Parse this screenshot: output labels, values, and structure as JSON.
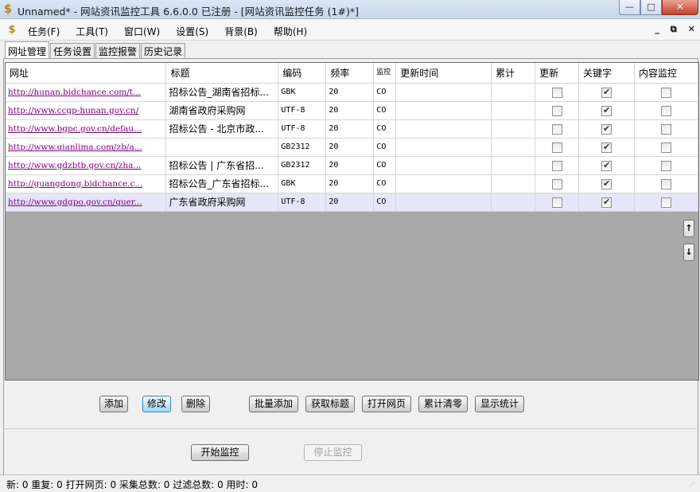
{
  "window": {
    "title": "Unnamed* - 网站资讯监控工具 6.6.0.0  已注册 - [网站资讯监控任务  (1#)*]",
    "app_icon": "$",
    "min_glyph": "—",
    "max_glyph": "□",
    "close_glyph": "✕"
  },
  "menu": {
    "items": [
      "任务(F)",
      "工具(T)",
      "窗口(W)",
      "设置(S)",
      "背景(B)",
      "帮助(H)"
    ],
    "mdi_min": "_",
    "mdi_restore": "⧉",
    "mdi_close": "✕"
  },
  "tabs": [
    "网址管理",
    "任务设置",
    "监控报警",
    "历史记录"
  ],
  "grid": {
    "columns": [
      "网址",
      "标题",
      "编码",
      "频率",
      "监控",
      "更新时间",
      "累计",
      "更新",
      "关键字",
      "内容监控"
    ],
    "rows": [
      {
        "url": "http://hunan.bidchance.com/t...",
        "title": "招标公告_湖南省招标...",
        "encoding": "GBK",
        "freq": "20",
        "monitor": "CO",
        "update_time": "",
        "total": "",
        "update": false,
        "keyword": true,
        "content": false
      },
      {
        "url": "http://www.ccgp-hunan.gov.cn/",
        "title": "湖南省政府采购网",
        "encoding": "UTF-8",
        "freq": "20",
        "monitor": "CO",
        "update_time": "",
        "total": "",
        "update": false,
        "keyword": true,
        "content": false
      },
      {
        "url": "http://www.bgpc.gov.cn/defau...",
        "title": "招标公告 - 北京市政...",
        "encoding": "UTF-8",
        "freq": "20",
        "monitor": "CO",
        "update_time": "",
        "total": "",
        "update": false,
        "keyword": true,
        "content": false
      },
      {
        "url": "http://www.qianlima.com/zb/a...",
        "title": "",
        "encoding": "GB2312",
        "freq": "20",
        "monitor": "CO",
        "update_time": "",
        "total": "",
        "update": false,
        "keyword": true,
        "content": false
      },
      {
        "url": "http://www.gdzbtb.gov.cn/zha...",
        "title": "招标公告 | 广东省招...",
        "encoding": "GB2312",
        "freq": "20",
        "monitor": "CO",
        "update_time": "",
        "total": "",
        "update": false,
        "keyword": true,
        "content": false
      },
      {
        "url": "http://guangdong.bidchance.c...",
        "title": "招标公告_广东省招标...",
        "encoding": "GBK",
        "freq": "20",
        "monitor": "CO",
        "update_time": "",
        "total": "",
        "update": false,
        "keyword": true,
        "content": false
      },
      {
        "url": "http://www.gdgpo.gov.cn/quer...",
        "title": "广东省政府采购网",
        "encoding": "UTF-8",
        "freq": "20",
        "monitor": "CO",
        "update_time": "",
        "total": "",
        "update": false,
        "keyword": true,
        "content": false
      }
    ],
    "selected_row": 6
  },
  "side_buttons": {
    "up": "↑",
    "down": "↓"
  },
  "buttons": {
    "add": "添加",
    "edit": "修改",
    "delete": "删除",
    "batch_add": "批量添加",
    "fetch_title": "获取标题",
    "open_page": "打开网页",
    "clear_total": "累计清零",
    "show_stats": "显示统计",
    "start": "开始监控",
    "stop": "停止监控"
  },
  "status": "新: 0  重复: 0  打开网页: 0  采集总数: 0  过滤总数: 0  用时: 0"
}
